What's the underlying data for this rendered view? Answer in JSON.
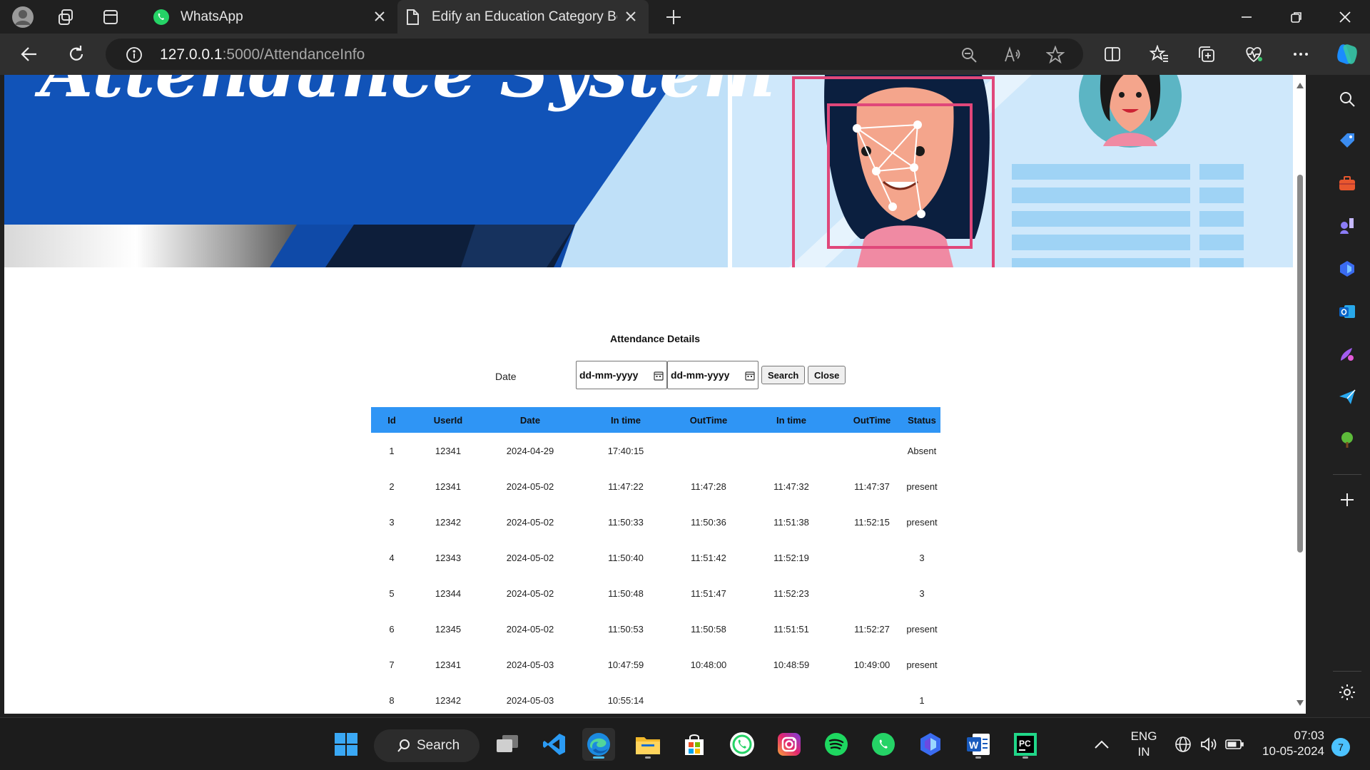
{
  "browser": {
    "tabs": [
      {
        "title": "WhatsApp",
        "icon": "whatsapp-icon",
        "active": false
      },
      {
        "title": "Edify an Education Category Boo",
        "icon": "page-icon",
        "active": true
      }
    ],
    "address": {
      "host": "127.0.0.1",
      "path": ":5000/AttendanceInfo"
    }
  },
  "banner": {
    "heading": "Attendance System"
  },
  "attendance": {
    "title": "Attendance Details",
    "date_label": "Date",
    "from_placeholder": "dd-mm-yyyy",
    "to_placeholder": "dd-mm-yyyy",
    "search_label": "Search",
    "close_label": "Close",
    "columns": [
      "Id",
      "UserId",
      "Date",
      "In time",
      "OutTime",
      "In time",
      "OutTime",
      "Status"
    ],
    "rows": [
      [
        "1",
        "12341",
        "2024-04-29",
        "17:40:15",
        "",
        "",
        "",
        "Absent"
      ],
      [
        "2",
        "12341",
        "2024-05-02",
        "11:47:22",
        "11:47:28",
        "11:47:32",
        "11:47:37",
        "present"
      ],
      [
        "3",
        "12342",
        "2024-05-02",
        "11:50:33",
        "11:50:36",
        "11:51:38",
        "11:52:15",
        "present"
      ],
      [
        "4",
        "12343",
        "2024-05-02",
        "11:50:40",
        "11:51:42",
        "11:52:19",
        "",
        "3"
      ],
      [
        "5",
        "12344",
        "2024-05-02",
        "11:50:48",
        "11:51:47",
        "11:52:23",
        "",
        "3"
      ],
      [
        "6",
        "12345",
        "2024-05-02",
        "11:50:53",
        "11:50:58",
        "11:51:51",
        "11:52:27",
        "present"
      ],
      [
        "7",
        "12341",
        "2024-05-03",
        "10:47:59",
        "10:48:00",
        "10:48:59",
        "10:49:00",
        "present"
      ],
      [
        "8",
        "12342",
        "2024-05-03",
        "10:55:14",
        "",
        "",
        "",
        "1"
      ]
    ]
  },
  "taskbar": {
    "search_label": "Search",
    "lang_line1": "ENG",
    "lang_line2": "IN",
    "time": "07:03",
    "date": "10-05-2024",
    "notification_count": "7"
  },
  "colors": {
    "table_header": "#2f95f5",
    "banner_blue": "#1153b8",
    "accent": "#4cc2ff"
  }
}
